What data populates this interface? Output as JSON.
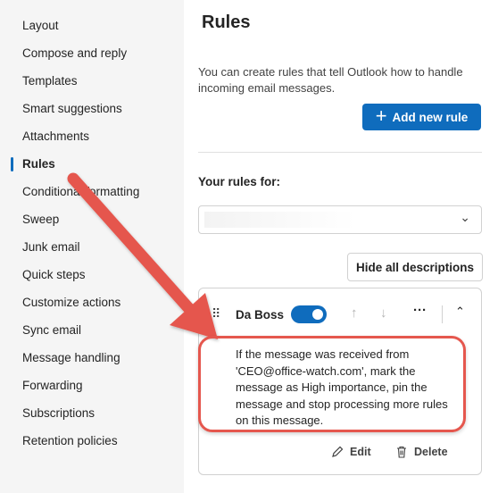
{
  "sidebar": {
    "items": [
      {
        "label": "Layout",
        "active": false
      },
      {
        "label": "Compose and reply",
        "active": false
      },
      {
        "label": "Templates",
        "active": false
      },
      {
        "label": "Smart suggestions",
        "active": false
      },
      {
        "label": "Attachments",
        "active": false
      },
      {
        "label": "Rules",
        "active": true
      },
      {
        "label": "Conditional formatting",
        "active": false
      },
      {
        "label": "Sweep",
        "active": false
      },
      {
        "label": "Junk email",
        "active": false
      },
      {
        "label": "Quick steps",
        "active": false
      },
      {
        "label": "Customize actions",
        "active": false
      },
      {
        "label": "Sync email",
        "active": false
      },
      {
        "label": "Message handling",
        "active": false
      },
      {
        "label": "Forwarding",
        "active": false
      },
      {
        "label": "Subscriptions",
        "active": false
      },
      {
        "label": "Retention policies",
        "active": false
      }
    ]
  },
  "main": {
    "title": "Rules",
    "intro": "You can create rules that tell Outlook how to handle incoming email messages.",
    "add_button": "Add new rule",
    "rules_for_label": "Your rules for:",
    "account_select_value": "",
    "hide_descriptions_button": "Hide all descriptions"
  },
  "rule": {
    "name": "Da Boss",
    "enabled": true,
    "description": "If the message was received from 'CEO@office-watch.com', mark the message as High importance, pin the message and stop processing more rules on this message.",
    "edit_label": "Edit",
    "delete_label": "Delete"
  },
  "colors": {
    "accent": "#0f6cbd",
    "annotation": "#e5574e",
    "sidebar_bg": "#f5f5f5"
  },
  "icons": {
    "add": "plus-icon",
    "select": "chevron-down-icon",
    "drag": "drag-handle-icon",
    "move_up": "arrow-up-icon",
    "move_down": "arrow-down-icon",
    "more": "more-icon",
    "collapse": "chevron-up-icon",
    "edit": "pencil-icon",
    "delete": "trash-icon"
  }
}
